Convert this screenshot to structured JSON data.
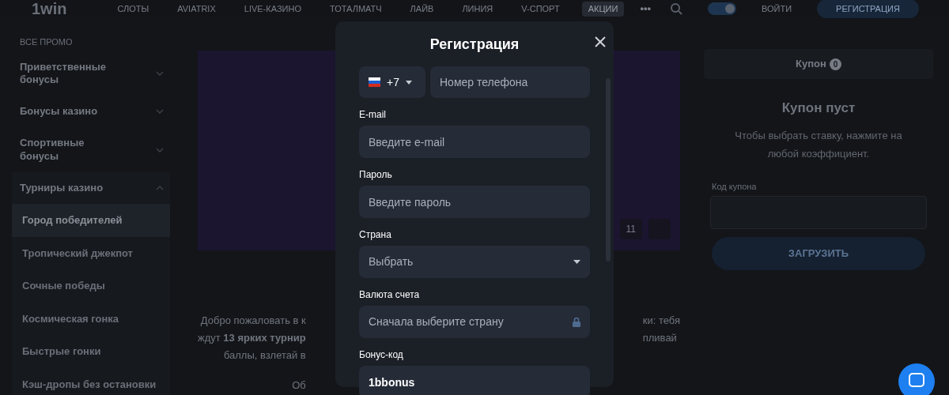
{
  "header": {
    "logo": "1win",
    "nav": [
      {
        "label": "СЛОТЫ",
        "selected": false
      },
      {
        "label": "AVIATRIX",
        "selected": false
      },
      {
        "label": "LIVE-КАЗИНО",
        "selected": false
      },
      {
        "label": "ТОТАЛМАТЧ",
        "selected": false
      },
      {
        "label": "ЛАЙВ",
        "selected": false
      },
      {
        "label": "ЛИНИЯ",
        "selected": false
      },
      {
        "label": "V-СПОРТ",
        "selected": false
      },
      {
        "label": "АКЦИИ",
        "selected": true
      }
    ],
    "more": "•••",
    "theme_toggle": {
      "on": true
    },
    "login": "ВОЙТИ",
    "register": "РЕГИСТРАЦИЯ"
  },
  "sidebar": {
    "title": "ВСЕ ПРОМО",
    "items": [
      {
        "label": "Приветственные бонусы",
        "expanded": false
      },
      {
        "label": "Бонусы казино",
        "expanded": false
      },
      {
        "label": "Спортивные бонусы",
        "expanded": false
      },
      {
        "label": "Турниры казино",
        "expanded": true,
        "children": [
          {
            "label": "Город победителей",
            "selected": true
          },
          {
            "label": "Тропический джекпот",
            "selected": false
          },
          {
            "label": "Сочные победы",
            "selected": false
          },
          {
            "label": "Космическая гонка",
            "selected": false
          },
          {
            "label": "Быстрые гонки",
            "selected": false
          },
          {
            "label": "Кэш-дропы без остановки",
            "selected": false
          }
        ]
      }
    ]
  },
  "promo": {
    "likes": "11",
    "text_left": [
      "Добро пожаловать в к",
      "ждут **13 ярких турнир**",
      "баллы, взлетай в"
    ],
    "text_right": [
      "ки: тебя",
      "пливай"
    ],
    "footer_left": "Об"
  },
  "coupon": {
    "tab": "Купон",
    "count": "0",
    "empty_title": "Купон пуст",
    "empty_text": "Чтобы выбрать ставку, нажмите на любой коэффициент.",
    "code_label": "Код купона",
    "load_button": "ЗАГРУЗИТЬ"
  },
  "modal": {
    "title": "Регистрация",
    "phone": {
      "code": "+7",
      "placeholder": "Номер телефона"
    },
    "fields": [
      {
        "kind": "input",
        "label": "E-mail",
        "placeholder": "Введите e-mail"
      },
      {
        "kind": "input",
        "label": "Пароль",
        "placeholder": "Введите пароль"
      },
      {
        "kind": "select",
        "label": "Страна",
        "placeholder": "Выбрать"
      },
      {
        "kind": "locked",
        "label": "Валюта счета",
        "placeholder": "Сначала выберите страну"
      },
      {
        "kind": "value",
        "label": "Бонус-код",
        "value": "1bbonus"
      }
    ]
  }
}
